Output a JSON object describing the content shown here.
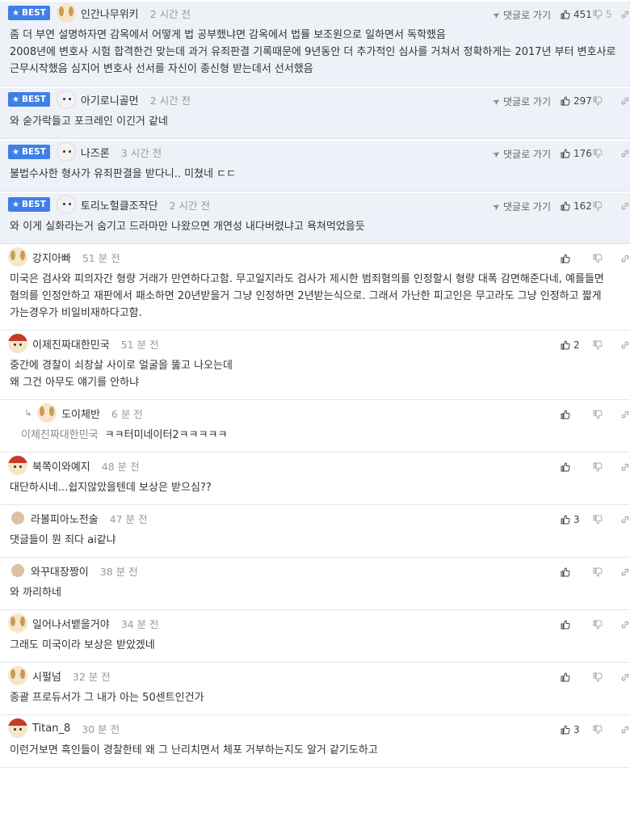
{
  "labels": {
    "best": "BEST",
    "goto": "댓글로 가기"
  },
  "colors": {
    "best_badge": "#3f7fe6",
    "best_bg": "#eef1f8"
  },
  "comments": [
    {
      "best": true,
      "avatar": "dog",
      "nick": "인간나무위키",
      "time": "2 시간 전",
      "up": "451",
      "down": "5",
      "lines": [
        "좀 더 부연 설명하자면 감옥에서 어떻게 법 공부했냐면 감옥에서 법률 보조원으로 일하면서 독학했음",
        "2008년에 변호사 시험 합격한건 맞는데 과거 유죄판결 기록때문에 9년동안 더 추가적인 심사를 거쳐서 정확하게는 2017년 부터 변호사로 근무시작했음 심지어 변호사 선서를 자신이 종신형 받는데서 선서했음"
      ]
    },
    {
      "best": true,
      "avatar": "white",
      "nick": "아기로니골먼",
      "time": "2 시간 전",
      "up": "297",
      "down": "",
      "lines": [
        "와 숟가락들고 포크레인 이긴거 같네"
      ]
    },
    {
      "best": true,
      "avatar": "white",
      "nick": "나즈론",
      "time": "3 시간 전",
      "up": "176",
      "down": "",
      "lines": [
        "불법수사한 형사가 유죄판결을 받다니.. 미쳤네 ㄷㄷ"
      ]
    },
    {
      "best": true,
      "avatar": "white",
      "nick": "토리노헐클조작단",
      "time": "2 시간 전",
      "up": "162",
      "down": "",
      "lines": [
        "와 이게 실화라는거 숨기고 드라마만 나왔으면 개연성 내다버렸냐고 욕쳐먹었을듯"
      ]
    },
    {
      "best": false,
      "avatar": "dog",
      "nick": "강지아빠",
      "time": "51 분 전",
      "up": "",
      "down": "",
      "lines": [
        "미국은 검사와 피의자간 형량 거래가 만연하다고함. 무고일지라도 검사가 제시한 범죄혐의를 인정할시 형량 대폭 감면해준다네, 예를들면 혐의를 인정안하고 재판에서 패소하면 20년받을거 그냥 인정하면 2년받는식으로. 그래서 가난한 피고인은 무고라도 그냥 인정하고 짧게 가는경우가 비일비재하다고함."
      ]
    },
    {
      "best": false,
      "avatar": "red",
      "nick": "이제진짜대한민국",
      "time": "51 분 전",
      "up": "2",
      "down": "",
      "lines": [
        "중간에 경찰이 쇠창살 사이로 얼굴을 뚫고 나오는데",
        "왜 그건 아무도 얘기를 안하냐"
      ]
    },
    {
      "best": false,
      "reply": true,
      "avatar": "dog",
      "nick": "도이체반",
      "time": "6 분 전",
      "up": "",
      "down": "",
      "parent": "이제진짜대한민국",
      "lines": [
        "ㅋㅋ터미네이터2ㅋㅋㅋㅋㅋ"
      ]
    },
    {
      "best": false,
      "avatar": "red",
      "nick": "북쪽이와예지",
      "time": "48 분 전",
      "up": "",
      "down": "",
      "lines": [
        "대단하시네...쉽지않았을텐데 보상은 받으심??"
      ]
    },
    {
      "best": false,
      "avatar": "plain",
      "nick": "라볼피아노전술",
      "time": "47 분 전",
      "up": "3",
      "down": "",
      "lines": [
        "댓글들이 뭔 죄다 ai같냐"
      ]
    },
    {
      "best": false,
      "avatar": "plain",
      "nick": "와꾸대장짱이",
      "time": "38 분 전",
      "up": "",
      "down": "",
      "lines": [
        "와 까리하네"
      ]
    },
    {
      "best": false,
      "avatar": "dog",
      "nick": "일어나서뱉을거야",
      "time": "34 분 전",
      "up": "",
      "down": "",
      "lines": [
        "그래도 미국이라 보상은 받았겠네"
      ]
    },
    {
      "best": false,
      "avatar": "dog",
      "nick": "시펄넘",
      "time": "32 분 전",
      "up": "",
      "down": "",
      "lines": [
        "종괄 프로듀서가 그 내가 아는 50센트인건가"
      ]
    },
    {
      "best": false,
      "avatar": "red",
      "nick": "Titan_8",
      "time": "30 분 전",
      "up": "3",
      "down": "",
      "lines": [
        "이런거보면 흑인들이 경찰한테 왜 그 난리치면서 체포 거부하는지도 알거 같기도하고"
      ]
    }
  ]
}
